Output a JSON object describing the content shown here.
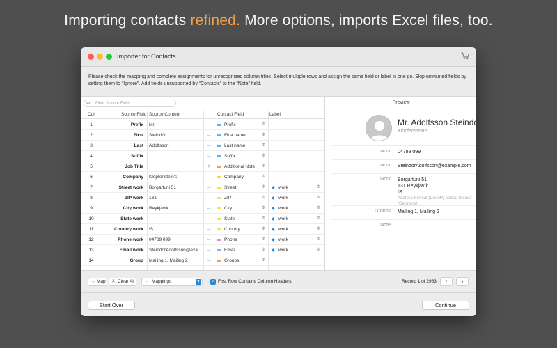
{
  "headline": {
    "prefix": "Importing contacts ",
    "accent": "refined.",
    "suffix": " More options, imports Excel files, too."
  },
  "window": {
    "title": "Importer for Contacts",
    "cart_icon": "cart-icon"
  },
  "instructions": "Please check the mapping and complete assignments for unrecognized column titles. Select multiple rows and assign the same field or label in one go. Skip unwanted fields by setting them to “Ignore”. Add fields unsupported by “Contacts” to the “Note” field.",
  "filter": {
    "placeholder": "Filter Source Field"
  },
  "columns": {
    "col": "Col",
    "source": "Source Field",
    "content": "Source Content",
    "field": "Contact Field",
    "label": "Label"
  },
  "colors": {
    "accent": "#f5a04a",
    "link_blue": "#2a86d0",
    "arrow_blue": "#29a3e0",
    "plus_blue": "#2a86d0"
  },
  "rows": [
    {
      "col": "1",
      "source": "Prefix",
      "content": "Mr.",
      "arrow": "→",
      "field": "Prefix",
      "swatch": "#5ab8e8",
      "label": ""
    },
    {
      "col": "2",
      "source": "First",
      "content": "Steindór",
      "arrow": "→",
      "field": "First name",
      "swatch": "#5ab8e8",
      "label": ""
    },
    {
      "col": "3",
      "source": "Last",
      "content": "Adolfsson",
      "arrow": "→",
      "field": "Last name",
      "swatch": "#5ab8e8",
      "label": ""
    },
    {
      "col": "4",
      "source": "Suffix",
      "content": "",
      "arrow": "→",
      "field": "Suffix",
      "swatch": "#5ab8e8",
      "label": ""
    },
    {
      "col": "5",
      "source": "Job Title",
      "content": "",
      "arrow": "+",
      "field": "Additional Note",
      "swatch": "#f5a04a",
      "label": ""
    },
    {
      "col": "6",
      "source": "Company",
      "content": "Klopfenstein's",
      "arrow": "→",
      "field": "Company",
      "swatch": "#f5d84a",
      "label": ""
    },
    {
      "col": "7",
      "source": "Street work",
      "content": "Borgartuni 51",
      "arrow": "→",
      "field": "Street",
      "swatch": "#f5e44a",
      "label": "work"
    },
    {
      "col": "8",
      "source": "ZIP work",
      "content": "131",
      "arrow": "→",
      "field": "ZIP",
      "swatch": "#f5e44a",
      "label": "work"
    },
    {
      "col": "9",
      "source": "City work",
      "content": "Reykjavík",
      "arrow": "→",
      "field": "City",
      "swatch": "#f5e44a",
      "label": "work"
    },
    {
      "col": "10",
      "source": "State work",
      "content": "",
      "arrow": "→",
      "field": "State",
      "swatch": "#f5e44a",
      "label": "work"
    },
    {
      "col": "11",
      "source": "Country work",
      "content": "IS",
      "arrow": "→",
      "field": "Country",
      "swatch": "#f5e44a",
      "label": "work"
    },
    {
      "col": "12",
      "source": "Phone work",
      "content": "04789 099",
      "arrow": "→",
      "field": "Phone",
      "swatch": "#f08ad0",
      "label": "work"
    },
    {
      "col": "13",
      "source": "Email work",
      "content": "SteindorAdolfsson@exa...",
      "arrow": "→",
      "field": "Email",
      "swatch": "#a8a0f0",
      "label": "work"
    },
    {
      "col": "14",
      "source": "Group",
      "content": "Mailing 1, Mailing 2",
      "arrow": "→",
      "field": "Groups",
      "swatch": "#f5a04a",
      "label": ""
    }
  ],
  "preview": {
    "header": "Preview",
    "name": "Mr. Adolfsson Steindór",
    "company": "Klopfenstein's",
    "phone": {
      "label": "work",
      "value": "04789 099"
    },
    "email": {
      "label": "work",
      "value": "SteindorAdolfsson@example.com"
    },
    "address": {
      "label": "work",
      "line1": "Borgartuni 51",
      "line2": "131 Reykjavík",
      "line3": "IS",
      "hint1": "Address Format (Country code): Default",
      "hint2": "(Germany)"
    },
    "groups": {
      "label": "Groups",
      "value": "Mailing 1, Mailing 2"
    },
    "note": {
      "label": "Note",
      "value": ""
    }
  },
  "toolbar": {
    "map_label": "Map",
    "clear_label": "Clear All",
    "mappings_label": "Mappings",
    "first_row_label": "First Row Contains Column Headers",
    "record_text": "Record 1 of 2983",
    "prev": "‹",
    "next": "›"
  },
  "footer": {
    "start_over": "Start Over",
    "continue": "Continue"
  }
}
